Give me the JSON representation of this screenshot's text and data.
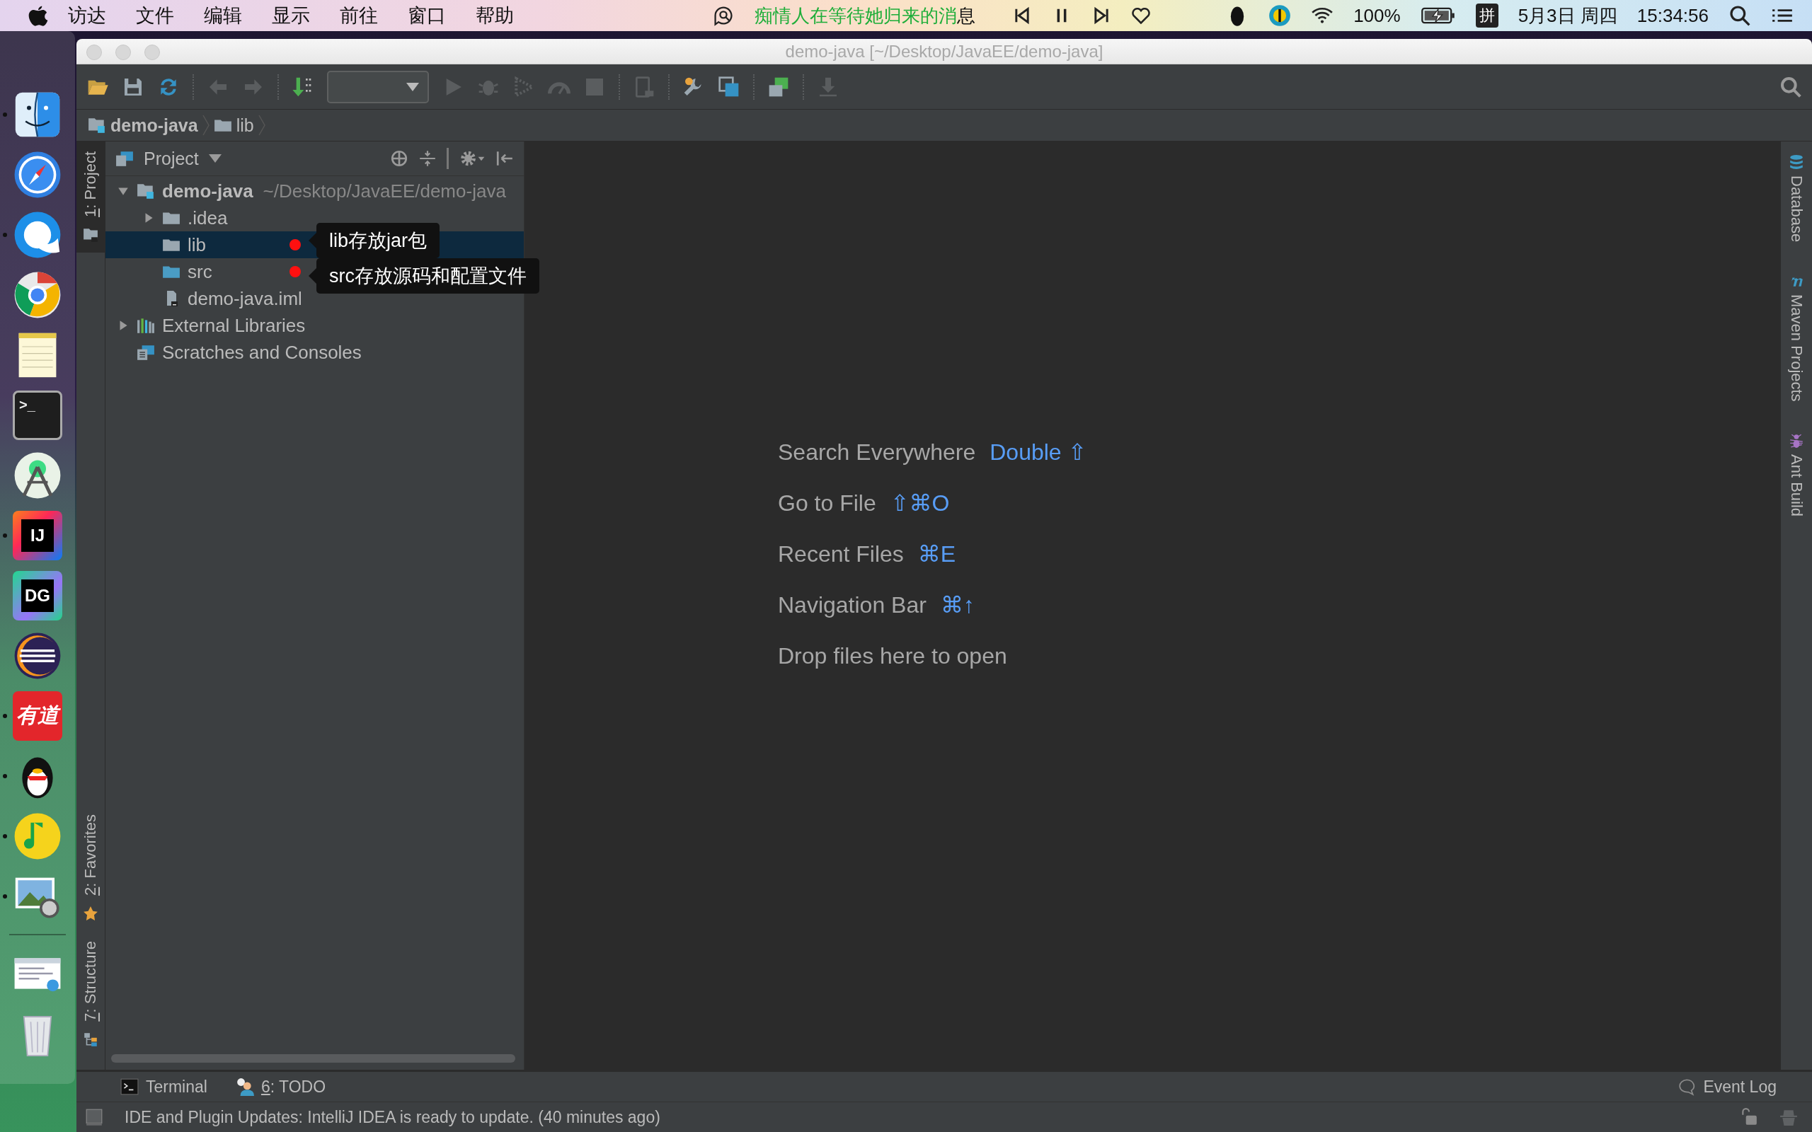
{
  "menu_bar": {
    "menus": [
      "访达",
      "文件",
      "编辑",
      "显示",
      "前往",
      "窗口",
      "帮助"
    ],
    "lyric_sung": "痴情人在等待她归来的消",
    "lyric_rest": "息",
    "battery": "100%",
    "input_method": "拼",
    "date": "5月3日 周四",
    "time": "15:34:56"
  },
  "dock": [
    {
      "kind": "finder",
      "running": true
    },
    {
      "kind": "safari",
      "running": false
    },
    {
      "kind": "browser",
      "running": true
    },
    {
      "kind": "chrome",
      "running": false
    },
    {
      "kind": "notes",
      "running": false
    },
    {
      "kind": "terminal",
      "label": ">_",
      "running": false
    },
    {
      "kind": "android",
      "running": false
    },
    {
      "kind": "intellij",
      "label": "IJ",
      "running": true
    },
    {
      "kind": "datagrip",
      "label": "DG",
      "running": false
    },
    {
      "kind": "eclipse",
      "running": false
    },
    {
      "kind": "youdao",
      "label": "有道",
      "running": true
    },
    {
      "kind": "qq",
      "running": true
    },
    {
      "kind": "music",
      "running": true
    },
    {
      "kind": "preview",
      "running": true
    },
    {
      "kind": "separator"
    },
    {
      "kind": "screenshot",
      "running": false
    },
    {
      "kind": "trash",
      "running": false
    }
  ],
  "window": {
    "title": "demo-java [~/Desktop/JavaEE/demo-java]"
  },
  "breadcrumbs": [
    {
      "kind": "module",
      "label": "demo-java"
    },
    {
      "kind": "folder",
      "label": "lib"
    }
  ],
  "left_stripe": [
    {
      "kind": "project",
      "mnemonic": "1",
      "label": ": Project",
      "selected": true
    },
    {
      "kind": "favorites",
      "mnemonic": "2",
      "label": ": Favorites",
      "selected": false
    },
    {
      "kind": "structure",
      "mnemonic": "7",
      "label": ": Structure",
      "selected": false
    }
  ],
  "project_panel": {
    "title": "Project",
    "tree": [
      {
        "kind": "module",
        "label": "demo-java",
        "path": "~/Desktop/JavaEE/demo-java",
        "expanded": true,
        "selected": false,
        "children": [
          {
            "kind": "folder",
            "label": ".idea",
            "expanded": false,
            "selected": false
          },
          {
            "kind": "folder",
            "label": "lib",
            "selected": true,
            "note": "lib存放jar包"
          },
          {
            "kind": "source-folder",
            "label": "src",
            "selected": false,
            "note": "src存放源码和配置文件"
          },
          {
            "kind": "iml",
            "label": "demo-java.iml",
            "selected": false
          }
        ]
      },
      {
        "kind": "libraries",
        "label": "External Libraries",
        "expanded": false,
        "selected": false
      },
      {
        "kind": "scratches",
        "label": "Scratches and Consoles",
        "selected": false
      }
    ]
  },
  "editor_hints": [
    {
      "action": "Search Everywhere",
      "shortcut": "Double ⇧"
    },
    {
      "action": "Go to File",
      "shortcut": "⇧⌘O"
    },
    {
      "action": "Recent Files",
      "shortcut": "⌘E"
    },
    {
      "action": "Navigation Bar",
      "shortcut": "⌘↑"
    },
    {
      "action": "Drop files here to open"
    }
  ],
  "right_stripe": [
    {
      "kind": "database",
      "label": "Database"
    },
    {
      "kind": "maven",
      "label": "Maven Projects"
    },
    {
      "kind": "ant",
      "label": "Ant Build"
    }
  ],
  "bottom_tools": [
    {
      "kind": "terminal",
      "label": "Terminal"
    },
    {
      "kind": "todo",
      "mnemonic": "6",
      "label": ": TODO"
    }
  ],
  "event_log": "Event Log",
  "status_bar": {
    "message": "IDE and Plugin Updates: IntelliJ IDEA is ready to update. (40 minutes ago)"
  }
}
